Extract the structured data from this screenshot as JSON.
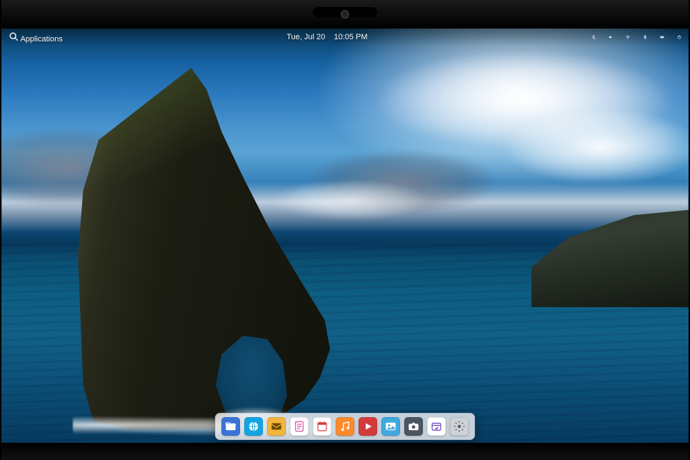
{
  "panel": {
    "applications_label": "Applications",
    "date_label": "Tue, Jul 20",
    "time_label": "10:05 PM",
    "indicators": {
      "nightlight": "nightlight-icon",
      "volume": "volume-icon",
      "network": "wifi-icon",
      "bluetooth": "bluetooth-icon",
      "power": "power-icon",
      "session": "session-icon"
    }
  },
  "dock": {
    "items": [
      {
        "name": "files",
        "label": "Files",
        "bg": "#3a74d8",
        "fg": "#ffffff"
      },
      {
        "name": "web-browser",
        "label": "Web",
        "bg": "#12a4e3",
        "fg": "#ffffff"
      },
      {
        "name": "mail",
        "label": "Mail",
        "bg": "#f3b63b",
        "fg": "#6b4a00"
      },
      {
        "name": "tasks",
        "label": "Tasks",
        "bg": "#ffffff",
        "fg": "#d84f9a"
      },
      {
        "name": "calendar",
        "label": "Calendar",
        "bg": "#ffffff",
        "fg": "#d64040"
      },
      {
        "name": "music",
        "label": "Music",
        "bg": "#ff8a2a",
        "fg": "#ffffff"
      },
      {
        "name": "videos",
        "label": "Videos",
        "bg": "#d23b3b",
        "fg": "#ffffff"
      },
      {
        "name": "photos",
        "label": "Photos",
        "bg": "#3fa8df",
        "fg": "#ffffff"
      },
      {
        "name": "camera",
        "label": "Camera",
        "bg": "#4b5560",
        "fg": "#ffffff"
      },
      {
        "name": "app-center",
        "label": "AppCenter",
        "bg": "#ffffff",
        "fg": "#6a3fbf"
      },
      {
        "name": "settings",
        "label": "System Settings",
        "bg": "#cfd3d8",
        "fg": "#555a60"
      }
    ]
  }
}
